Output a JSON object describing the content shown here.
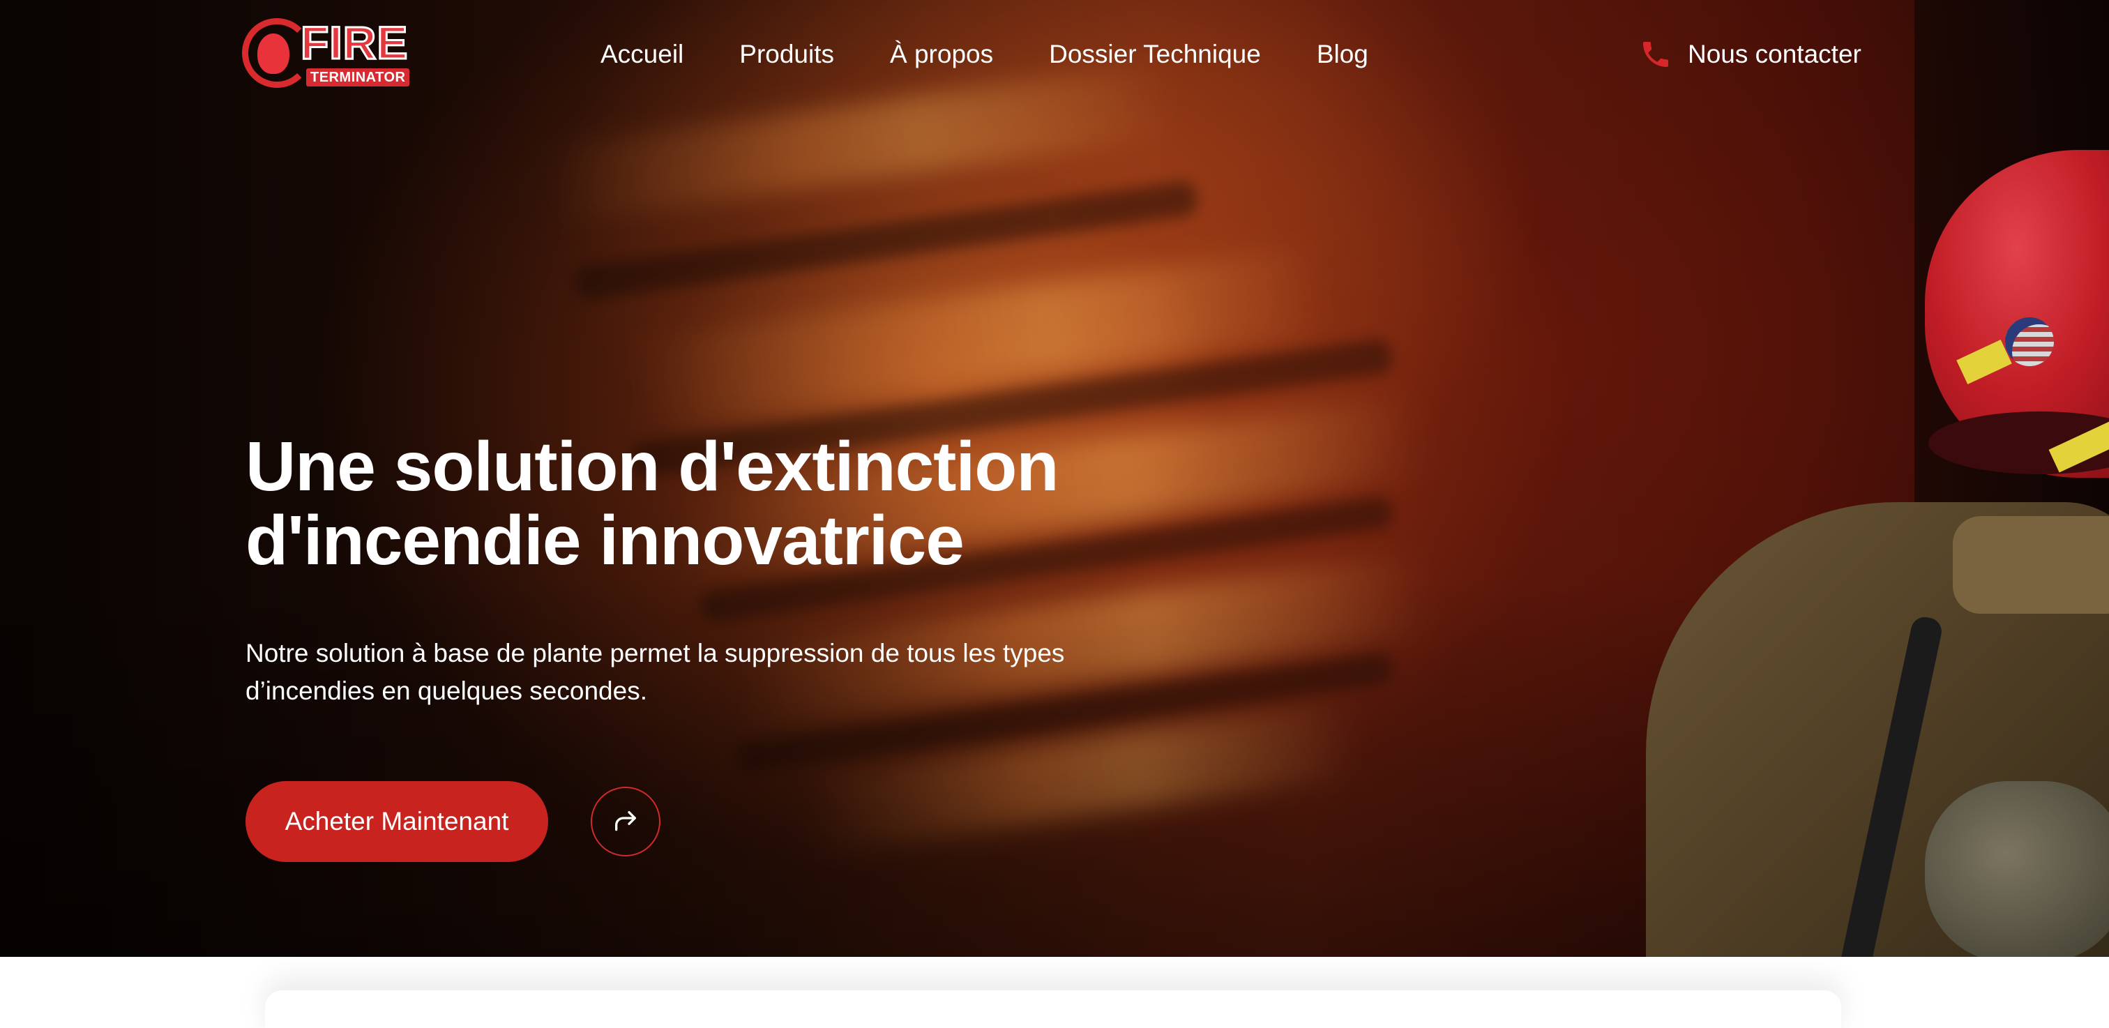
{
  "brand": {
    "logo_word": "FIRE",
    "logo_sub": "TERMINATOR",
    "accent_color": "#c8231f"
  },
  "nav": {
    "links": [
      {
        "label": "Accueil"
      },
      {
        "label": "Produits"
      },
      {
        "label": "À propos"
      },
      {
        "label": "Dossier Technique"
      },
      {
        "label": "Blog"
      }
    ],
    "contact": {
      "label": "Nous contacter",
      "icon": "phone-icon"
    }
  },
  "hero": {
    "title_line1": "Une solution d'extinction",
    "title_line2": "d'incendie innovatrice",
    "description": "Notre solution à base de plante permet la suppression de tous les types d’incendies en quelques secondes.",
    "cta_label": "Acheter Maintenant",
    "secondary_icon": "share-arrow-icon"
  }
}
